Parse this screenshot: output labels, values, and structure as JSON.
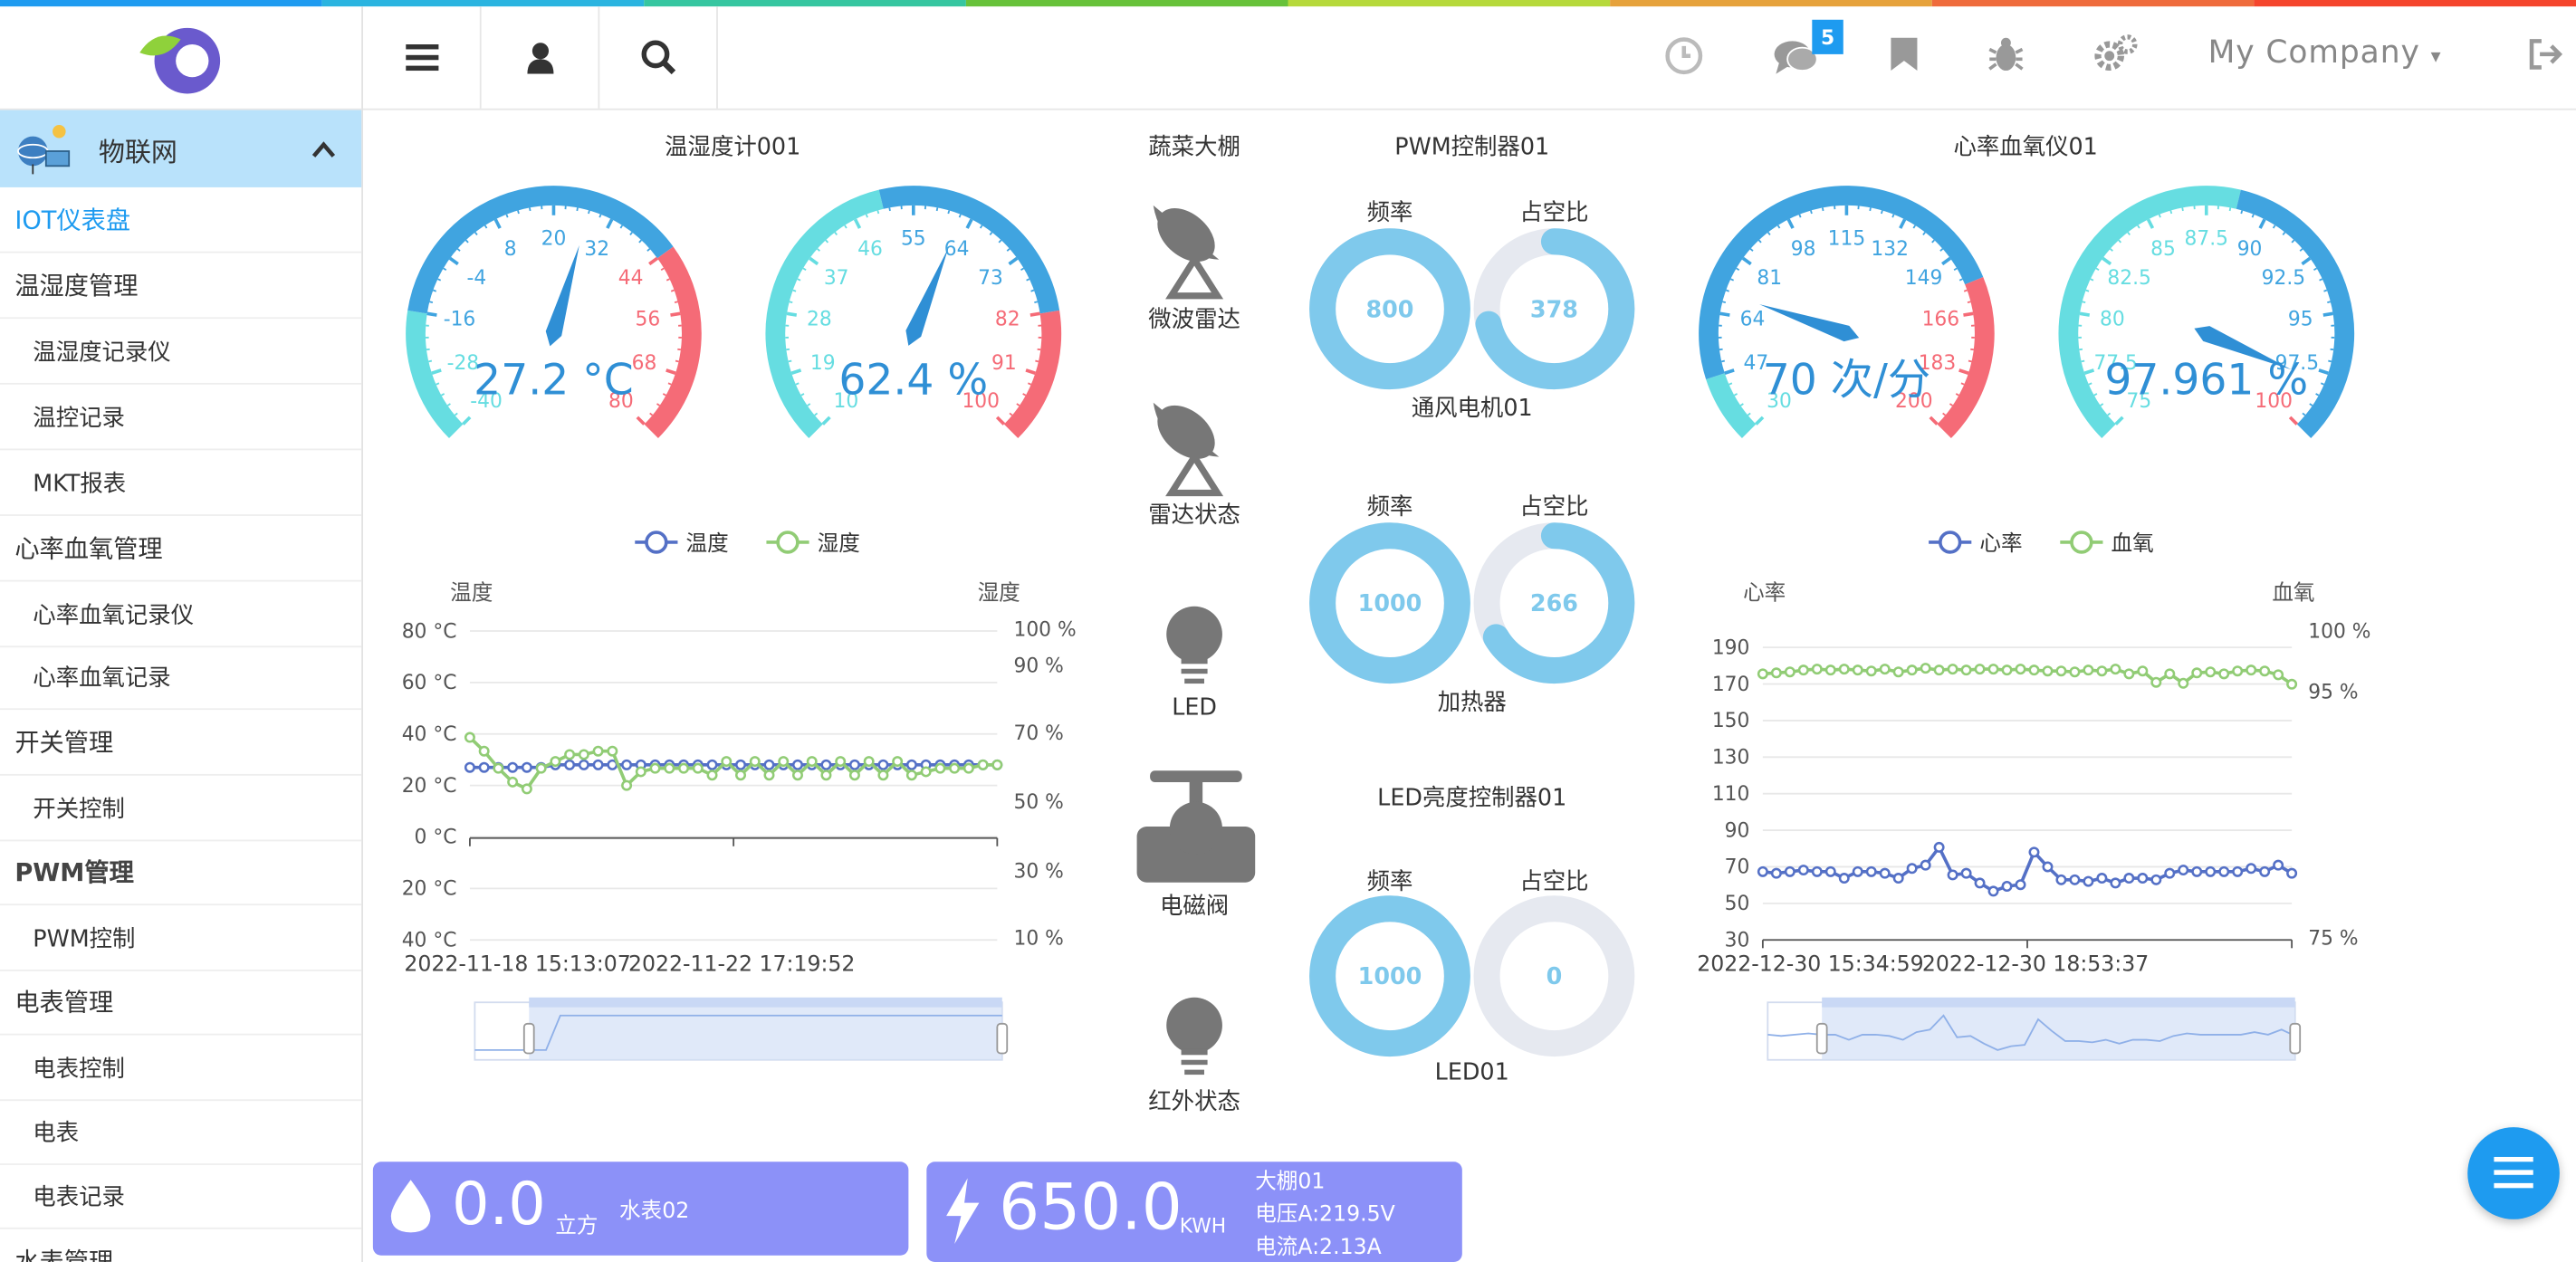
{
  "header": {
    "company": "My Company",
    "badge": "5"
  },
  "sidebar": {
    "group": "物联网",
    "items": [
      {
        "label": "IOT仪表盘",
        "level": "top",
        "active": true
      },
      {
        "label": "温湿度管理",
        "level": "top"
      },
      {
        "label": "温湿度记录仪",
        "level": "sub"
      },
      {
        "label": "温控记录",
        "level": "sub"
      },
      {
        "label": "MKT报表",
        "level": "sub"
      },
      {
        "label": "心率血氧管理",
        "level": "top"
      },
      {
        "label": "心率血氧记录仪",
        "level": "sub"
      },
      {
        "label": "心率血氧记录",
        "level": "sub"
      },
      {
        "label": "开关管理",
        "level": "top"
      },
      {
        "label": "开关控制",
        "level": "sub"
      },
      {
        "label": "PWM管理",
        "level": "top",
        "bold": true
      },
      {
        "label": "PWM控制",
        "level": "sub"
      },
      {
        "label": "电表管理",
        "level": "top"
      },
      {
        "label": "电表控制",
        "level": "sub"
      },
      {
        "label": "电表",
        "level": "sub"
      },
      {
        "label": "电表记录",
        "level": "sub"
      },
      {
        "label": "水表管理",
        "level": "top"
      }
    ]
  },
  "dashboard": {
    "thermo": {
      "title": "温湿度计001",
      "temp_gauge": {
        "value": 27.2,
        "display": "27.2 °C",
        "min": -40,
        "max": 80,
        "ticks": [
          "-40",
          "-28",
          "-16",
          "-4",
          "8",
          "20",
          "32",
          "44",
          "56",
          "68",
          "80"
        ]
      },
      "hum_gauge": {
        "value": 62.4,
        "display": "62.4 %",
        "min": 10,
        "max": 100,
        "ticks": [
          "10",
          "19",
          "28",
          "37",
          "46",
          "55",
          "64",
          "73",
          "82",
          "91",
          "100"
        ]
      }
    },
    "greenhouse": {
      "title": "蔬菜大棚",
      "devices": [
        "微波雷达",
        "雷达状态",
        "LED",
        "电磁阀",
        "红外状态"
      ]
    },
    "pwm": {
      "title": "PWM控制器01",
      "groups": [
        {
          "name": "通风电机01",
          "freq_label": "频率",
          "duty_label": "占空比",
          "freq": 800,
          "duty": 378
        },
        {
          "name": "加热器",
          "freq_label": "频率",
          "duty_label": "占空比",
          "freq": 1000,
          "duty": 266
        }
      ],
      "led_title": "LED亮度控制器01",
      "led": {
        "name": "LED01",
        "freq_label": "频率",
        "duty_label": "占空比",
        "freq": 1000,
        "duty": 0
      }
    },
    "heart": {
      "title": "心率血氧仪01",
      "hr_gauge": {
        "value": 70,
        "display": "70 次/分",
        "min": 30,
        "max": 200,
        "ticks": [
          "30",
          "47",
          "64",
          "81",
          "98",
          "115",
          "132",
          "149",
          "166",
          "183",
          "200"
        ]
      },
      "spo2_gauge": {
        "value": 97.961,
        "display": "97.961 %",
        "min": 75,
        "max": 100,
        "ticks": [
          "75",
          "77.5",
          "80",
          "82.5",
          "85",
          "87.5",
          "90",
          "92.5",
          "95",
          "97.5",
          "100"
        ]
      }
    },
    "water": {
      "value": "0.0",
      "unit": "立方",
      "name": "水表02"
    },
    "power": {
      "value": "650.0",
      "unit": "KWH",
      "name": "大棚01",
      "voltage": "电压A:219.5V",
      "current": "电流A:2.13A"
    }
  },
  "chart_data": [
    {
      "type": "line",
      "legend": [
        "温度",
        "湿度"
      ],
      "ylabel_left": "温度",
      "ylabel_right": "湿度",
      "left_ticks": [
        "80 °C",
        "60 °C",
        "40 °C",
        "20 °C",
        "0 °C",
        "20 °C",
        "40 °C"
      ],
      "right_ticks": [
        "100 %",
        "90 %",
        "70 %",
        "50 %",
        "30 %",
        "10 %"
      ],
      "x_labels": [
        "2022-11-18 15:13:07",
        "2022-11-22 17:19:52"
      ],
      "series": [
        {
          "name": "温度",
          "color": "#5470c6",
          "unit": "°C",
          "range": [
            -40,
            80
          ],
          "values": [
            27,
            27,
            27,
            27,
            27,
            27,
            28,
            28,
            28,
            28,
            28,
            28,
            28,
            28,
            28,
            28,
            28,
            28,
            28,
            28,
            28,
            28,
            28,
            28,
            28,
            28,
            28,
            28,
            28,
            28,
            28,
            28,
            28,
            28,
            28,
            28,
            28,
            28
          ]
        },
        {
          "name": "湿度",
          "color": "#91cc75",
          "unit": "%",
          "range": [
            10,
            100
          ],
          "values": [
            69,
            65,
            60,
            56,
            54,
            60,
            62,
            64,
            64,
            65,
            65,
            55,
            59,
            60,
            60,
            60,
            60,
            58,
            62,
            58,
            62,
            58,
            62,
            58,
            62,
            58,
            62,
            58,
            62,
            58,
            62,
            58,
            59,
            60,
            60,
            60,
            61,
            61
          ]
        }
      ]
    },
    {
      "type": "line",
      "legend": [
        "心率",
        "血氧"
      ],
      "ylabel_left": "心率",
      "ylabel_right": "血氧",
      "left_ticks": [
        "190",
        "170",
        "150",
        "130",
        "110",
        "90",
        "70",
        "50",
        "30"
      ],
      "right_ticks": [
        "100 %",
        "95 %",
        "75 %"
      ],
      "x_labels": [
        "2022-12-30 15:34:59",
        "2022-12-30 18:53:37"
      ],
      "series": [
        {
          "name": "心率",
          "color": "#5470c6",
          "range": [
            30,
            210
          ],
          "values": [
            72,
            71,
            72,
            73,
            72,
            72,
            68,
            72,
            72,
            71,
            68,
            74,
            76,
            87,
            70,
            71,
            65,
            60,
            63,
            64,
            84,
            75,
            67,
            67,
            66,
            68,
            65,
            68,
            68,
            67,
            71,
            73,
            72,
            72,
            72,
            72,
            74,
            72,
            76,
            71
          ]
        },
        {
          "name": "血氧",
          "color": "#91cc75",
          "unit": "%",
          "range": [
            70,
            101
          ],
          "values": [
            98.2,
            98.3,
            98.4,
            98.6,
            98.7,
            98.6,
            98.7,
            98.6,
            98.5,
            98.7,
            98.4,
            98.6,
            98.8,
            98.6,
            98.7,
            98.6,
            98.7,
            98.7,
            98.6,
            98.7,
            98.6,
            98.5,
            98.5,
            98.4,
            98.6,
            98.5,
            98.7,
            98.2,
            98.5,
            97.3,
            98.2,
            97.2,
            98.3,
            98.4,
            98.2,
            98.5,
            98.6,
            98.5,
            98.1,
            97.1
          ]
        }
      ]
    }
  ]
}
